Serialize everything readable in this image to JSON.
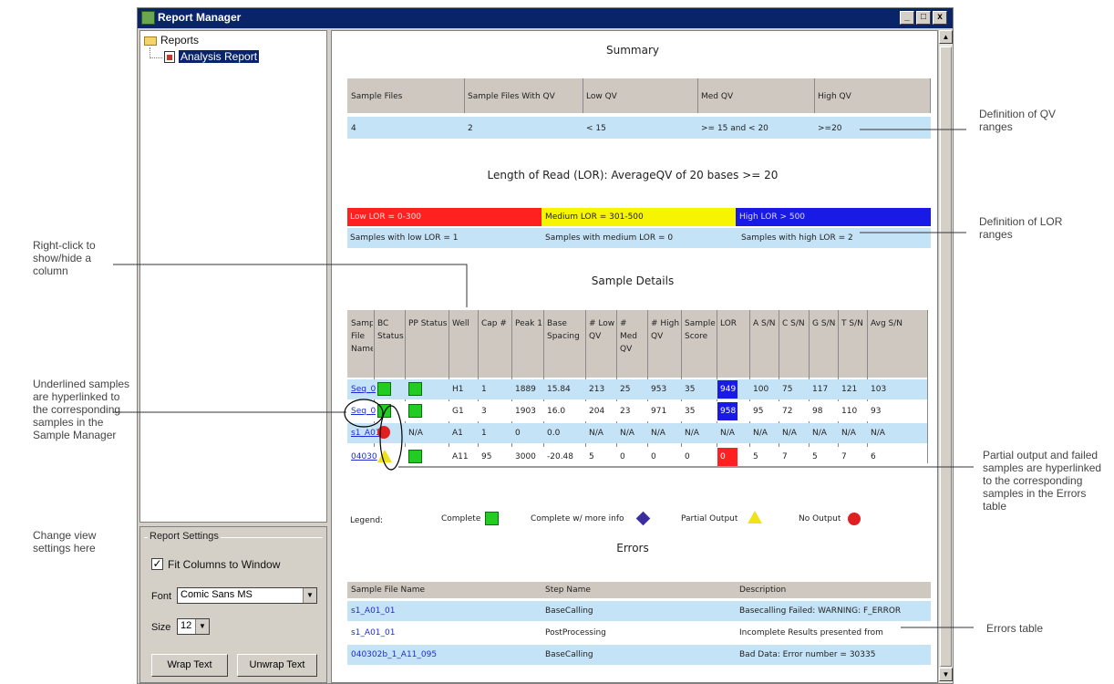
{
  "window": {
    "title": "Report Manager",
    "min": "_",
    "max": "□",
    "close": "x"
  },
  "tree": {
    "root": "Reports",
    "child": "Analysis Report"
  },
  "settings": {
    "group_title": "Report Settings",
    "fit_columns": "Fit Columns to Window",
    "fit_checked": "✓",
    "font_label": "Font",
    "font_value": "Comic Sans MS",
    "size_label": "Size",
    "size_value": "12",
    "wrap_label": "Wrap Text",
    "unwrap_label": "Unwrap Text"
  },
  "summary": {
    "title": "Summary",
    "headers": [
      "Sample Files",
      "Sample Files With QV",
      "Low QV",
      "Med QV",
      "High QV"
    ],
    "values": [
      "4",
      "2",
      "< 15",
      ">= 15 and < 20",
      ">=20"
    ]
  },
  "lor": {
    "title": "Length of Read (LOR): AverageQV of 20 bases >= 20",
    "low": "Low LOR = 0-300",
    "medium": "Medium LOR = 301-500",
    "high": "High LOR > 500",
    "low_count": "Samples with low LOR = 1",
    "medium_count": "Samples with medium LOR = 0",
    "high_count": "Samples with high LOR = 2",
    "colors": {
      "low": "#ff2020",
      "medium": "#f7f400",
      "high": "#1a1ae6"
    }
  },
  "details": {
    "title": "Sample Details",
    "headers": [
      "Sample File Name",
      "BC Status",
      "PP Status",
      "Well",
      "Cap #",
      "Peak 1",
      "Base Spacing",
      "# Low QV",
      "# Med QV",
      "# High QV",
      "Sample Score",
      "LOR",
      "A S/N",
      "C S/N",
      "G S/N",
      "T S/N",
      "Avg S/N"
    ],
    "rows": [
      {
        "name": "Seq_0",
        "bc": "complete",
        "pp": "complete",
        "well": "H1",
        "cap": "1",
        "peak": "1889",
        "spacing": "15.84",
        "low": "213",
        "med": "25",
        "high": "953",
        "score": "35",
        "lor": "949",
        "a": "100",
        "c": "75",
        "g": "117",
        "t": "121",
        "avg": "103"
      },
      {
        "name": "Seq_0",
        "bc": "complete",
        "pp": "complete",
        "well": "G1",
        "cap": "3",
        "peak": "1903",
        "spacing": "16.0",
        "low": "204",
        "med": "23",
        "high": "971",
        "score": "35",
        "lor": "958",
        "a": "95",
        "c": "72",
        "g": "98",
        "t": "110",
        "avg": "93"
      },
      {
        "name": "s1_A01",
        "bc": "nooutput",
        "pp": "N/A",
        "well": "A1",
        "cap": "1",
        "peak": "0",
        "spacing": "0.0",
        "low": "N/A",
        "med": "N/A",
        "high": "N/A",
        "score": "N/A",
        "lor": "N/A",
        "a": "N/A",
        "c": "N/A",
        "g": "N/A",
        "t": "N/A",
        "avg": "N/A"
      },
      {
        "name": "04030",
        "bc": "partial",
        "pp": "complete",
        "well": "A11",
        "cap": "95",
        "peak": "3000",
        "spacing": "-20.48",
        "low": "5",
        "med": "0",
        "high": "0",
        "score": "0",
        "lor": "0",
        "a": "5",
        "c": "7",
        "g": "5",
        "t": "7",
        "avg": "6"
      }
    ]
  },
  "legend": {
    "label": "Legend:",
    "complete": "Complete",
    "complete_more": "Complete w/ more info",
    "partial": "Partial Output",
    "no_output": "No Output"
  },
  "errors": {
    "title": "Errors",
    "headers": [
      "Sample File Name",
      "Step Name",
      "Description"
    ],
    "rows": [
      {
        "name": "s1_A01_01",
        "step": "BaseCalling",
        "desc": "Basecalling Failed: WARNING: F_ERROR"
      },
      {
        "name": "s1_A01_01",
        "step": "PostProcessing",
        "desc": "Incomplete Results presented from"
      },
      {
        "name": "040302b_1_A11_095",
        "step": "BaseCalling",
        "desc": "Bad Data: Error number = 30335"
      }
    ]
  },
  "annotations": {
    "qv": "Definition of QV ranges",
    "lor": "Definition of LOR ranges",
    "rightclick": "Right-click to show/hide a column",
    "underlined": "Underlined samples are hyperlinked to the corresponding samples in the Sample Manager",
    "partial": "Partial output and failed samples are hyperlinked to the corresponding samples in the Errors table",
    "view": "Change view settings here",
    "errors": "Errors table"
  }
}
